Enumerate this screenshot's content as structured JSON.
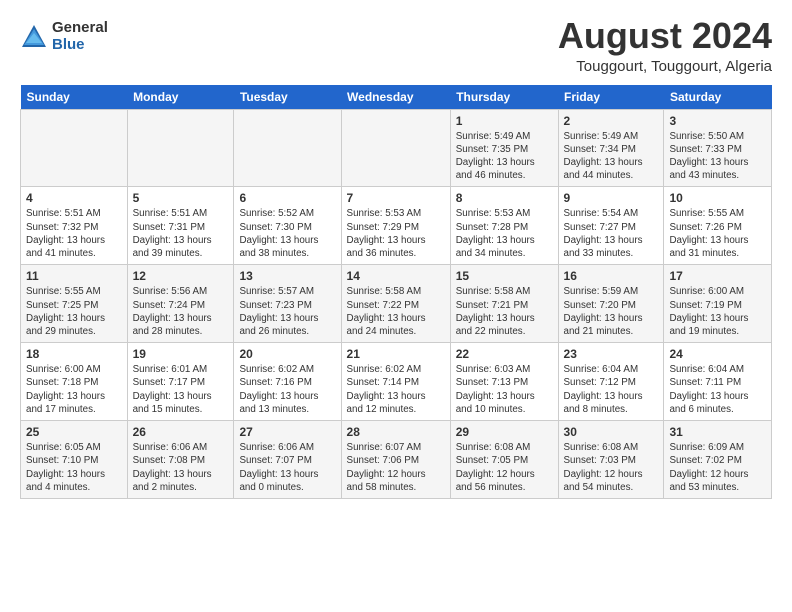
{
  "logo": {
    "general": "General",
    "blue": "Blue"
  },
  "title": {
    "month_year": "August 2024",
    "location": "Touggourt, Touggourt, Algeria"
  },
  "headers": [
    "Sunday",
    "Monday",
    "Tuesday",
    "Wednesday",
    "Thursday",
    "Friday",
    "Saturday"
  ],
  "weeks": [
    [
      {
        "day": "",
        "info": ""
      },
      {
        "day": "",
        "info": ""
      },
      {
        "day": "",
        "info": ""
      },
      {
        "day": "",
        "info": ""
      },
      {
        "day": "1",
        "info": "Sunrise: 5:49 AM\nSunset: 7:35 PM\nDaylight: 13 hours\nand 46 minutes."
      },
      {
        "day": "2",
        "info": "Sunrise: 5:49 AM\nSunset: 7:34 PM\nDaylight: 13 hours\nand 44 minutes."
      },
      {
        "day": "3",
        "info": "Sunrise: 5:50 AM\nSunset: 7:33 PM\nDaylight: 13 hours\nand 43 minutes."
      }
    ],
    [
      {
        "day": "4",
        "info": "Sunrise: 5:51 AM\nSunset: 7:32 PM\nDaylight: 13 hours\nand 41 minutes."
      },
      {
        "day": "5",
        "info": "Sunrise: 5:51 AM\nSunset: 7:31 PM\nDaylight: 13 hours\nand 39 minutes."
      },
      {
        "day": "6",
        "info": "Sunrise: 5:52 AM\nSunset: 7:30 PM\nDaylight: 13 hours\nand 38 minutes."
      },
      {
        "day": "7",
        "info": "Sunrise: 5:53 AM\nSunset: 7:29 PM\nDaylight: 13 hours\nand 36 minutes."
      },
      {
        "day": "8",
        "info": "Sunrise: 5:53 AM\nSunset: 7:28 PM\nDaylight: 13 hours\nand 34 minutes."
      },
      {
        "day": "9",
        "info": "Sunrise: 5:54 AM\nSunset: 7:27 PM\nDaylight: 13 hours\nand 33 minutes."
      },
      {
        "day": "10",
        "info": "Sunrise: 5:55 AM\nSunset: 7:26 PM\nDaylight: 13 hours\nand 31 minutes."
      }
    ],
    [
      {
        "day": "11",
        "info": "Sunrise: 5:55 AM\nSunset: 7:25 PM\nDaylight: 13 hours\nand 29 minutes."
      },
      {
        "day": "12",
        "info": "Sunrise: 5:56 AM\nSunset: 7:24 PM\nDaylight: 13 hours\nand 28 minutes."
      },
      {
        "day": "13",
        "info": "Sunrise: 5:57 AM\nSunset: 7:23 PM\nDaylight: 13 hours\nand 26 minutes."
      },
      {
        "day": "14",
        "info": "Sunrise: 5:58 AM\nSunset: 7:22 PM\nDaylight: 13 hours\nand 24 minutes."
      },
      {
        "day": "15",
        "info": "Sunrise: 5:58 AM\nSunset: 7:21 PM\nDaylight: 13 hours\nand 22 minutes."
      },
      {
        "day": "16",
        "info": "Sunrise: 5:59 AM\nSunset: 7:20 PM\nDaylight: 13 hours\nand 21 minutes."
      },
      {
        "day": "17",
        "info": "Sunrise: 6:00 AM\nSunset: 7:19 PM\nDaylight: 13 hours\nand 19 minutes."
      }
    ],
    [
      {
        "day": "18",
        "info": "Sunrise: 6:00 AM\nSunset: 7:18 PM\nDaylight: 13 hours\nand 17 minutes."
      },
      {
        "day": "19",
        "info": "Sunrise: 6:01 AM\nSunset: 7:17 PM\nDaylight: 13 hours\nand 15 minutes."
      },
      {
        "day": "20",
        "info": "Sunrise: 6:02 AM\nSunset: 7:16 PM\nDaylight: 13 hours\nand 13 minutes."
      },
      {
        "day": "21",
        "info": "Sunrise: 6:02 AM\nSunset: 7:14 PM\nDaylight: 13 hours\nand 12 minutes."
      },
      {
        "day": "22",
        "info": "Sunrise: 6:03 AM\nSunset: 7:13 PM\nDaylight: 13 hours\nand 10 minutes."
      },
      {
        "day": "23",
        "info": "Sunrise: 6:04 AM\nSunset: 7:12 PM\nDaylight: 13 hours\nand 8 minutes."
      },
      {
        "day": "24",
        "info": "Sunrise: 6:04 AM\nSunset: 7:11 PM\nDaylight: 13 hours\nand 6 minutes."
      }
    ],
    [
      {
        "day": "25",
        "info": "Sunrise: 6:05 AM\nSunset: 7:10 PM\nDaylight: 13 hours\nand 4 minutes."
      },
      {
        "day": "26",
        "info": "Sunrise: 6:06 AM\nSunset: 7:08 PM\nDaylight: 13 hours\nand 2 minutes."
      },
      {
        "day": "27",
        "info": "Sunrise: 6:06 AM\nSunset: 7:07 PM\nDaylight: 13 hours\nand 0 minutes."
      },
      {
        "day": "28",
        "info": "Sunrise: 6:07 AM\nSunset: 7:06 PM\nDaylight: 12 hours\nand 58 minutes."
      },
      {
        "day": "29",
        "info": "Sunrise: 6:08 AM\nSunset: 7:05 PM\nDaylight: 12 hours\nand 56 minutes."
      },
      {
        "day": "30",
        "info": "Sunrise: 6:08 AM\nSunset: 7:03 PM\nDaylight: 12 hours\nand 54 minutes."
      },
      {
        "day": "31",
        "info": "Sunrise: 6:09 AM\nSunset: 7:02 PM\nDaylight: 12 hours\nand 53 minutes."
      }
    ]
  ]
}
